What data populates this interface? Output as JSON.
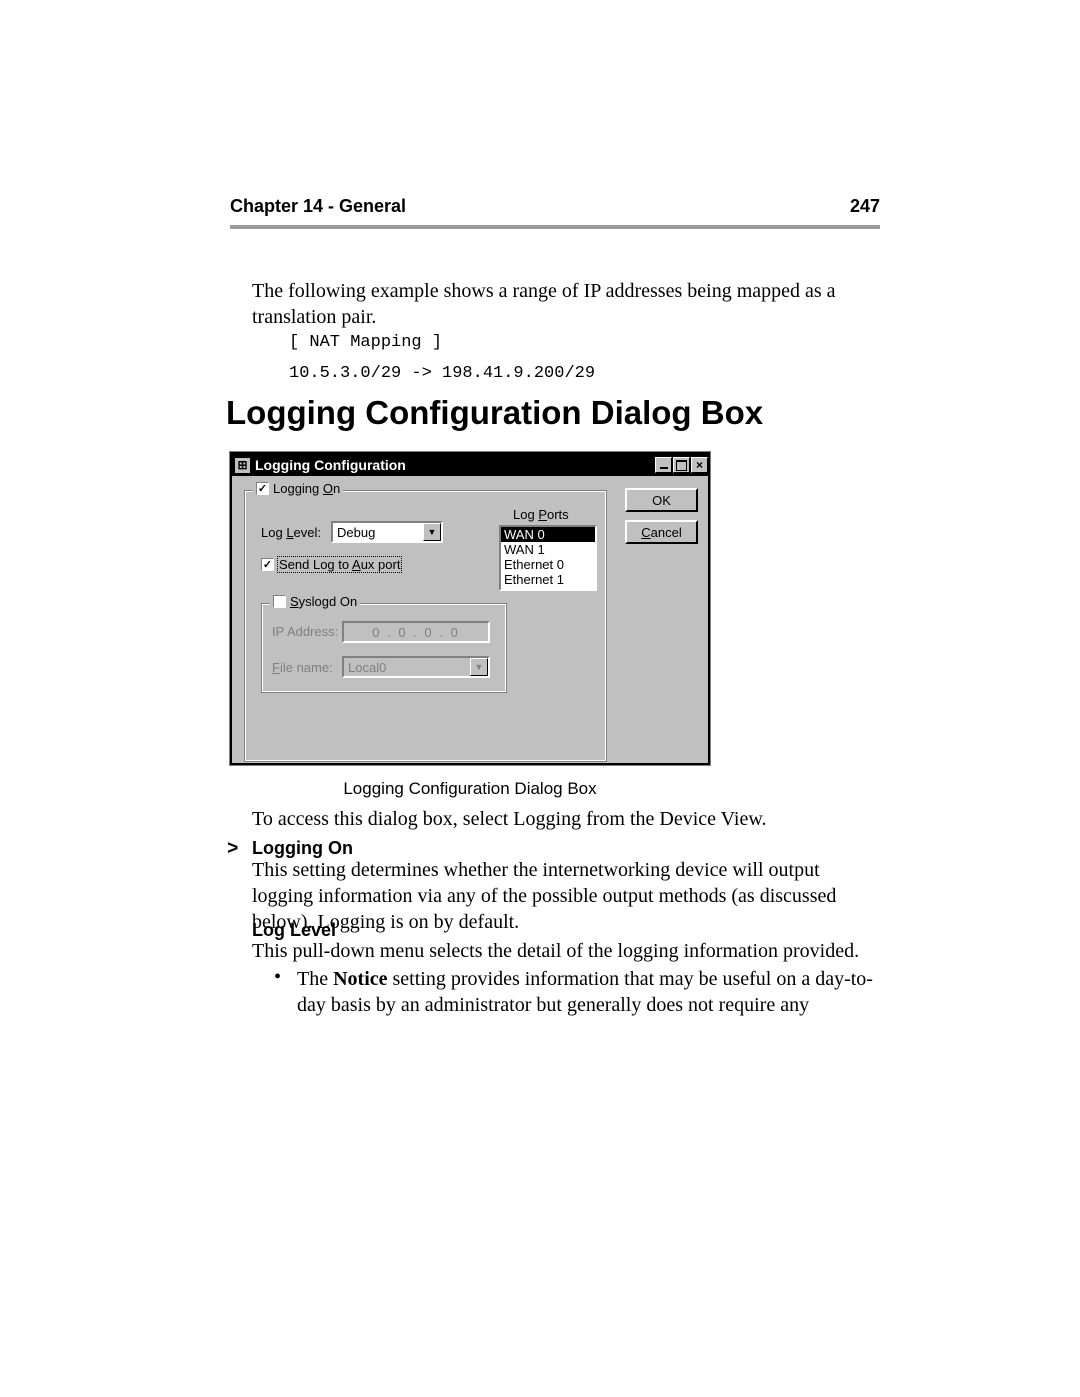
{
  "header": {
    "chapter": "Chapter 14 - General",
    "page": "247"
  },
  "intro": "The following example shows a range of IP addresses being mapped as a translation pair.",
  "code": "[ NAT Mapping ]\n10.5.3.0/29 -> 198.41.9.200/29",
  "section_heading": "Logging Configuration Dialog Box",
  "dialog": {
    "title": "Logging Configuration",
    "logging_on": {
      "label_pre": "Logging ",
      "label_u": "O",
      "label_post": "n",
      "checked": true
    },
    "log_level": {
      "label_pre": "Log ",
      "label_u": "L",
      "label_post": "evel:",
      "value": "Debug"
    },
    "aux": {
      "label_pre": "Send Log to ",
      "label_u": "A",
      "label_post": "ux port",
      "checked": true
    },
    "syslogd": {
      "label_u": "S",
      "label_post": "yslogd On",
      "checked": false
    },
    "ip_address_label": "IP Address:",
    "ip_address_value": "0  .  0  .  0  .  0",
    "file_name_label_u": "F",
    "file_name_label_post": "ile name:",
    "file_name_value": "Local0",
    "log_ports": {
      "label_pre": "Log ",
      "label_u": "P",
      "label_post": "orts",
      "items": [
        "WAN 0",
        "WAN 1",
        "Ethernet 0",
        "Ethernet 1"
      ],
      "selected_index": 0
    },
    "buttons": {
      "ok": "OK",
      "cancel_u": "C",
      "cancel_post": "ancel"
    }
  },
  "caption": "Logging Configuration Dialog Box",
  "access_para": "To access this dialog box, select Logging from the Device View.",
  "sub1": {
    "heading": "Logging On",
    "marker": ">",
    "text": "This setting determines whether the internetworking device will output logging information via any of the possible output methods (as discussed below). Logging is on by default."
  },
  "sub2": {
    "heading": "Log Level",
    "text": "This pull-down menu selects the detail of the logging information provided."
  },
  "bullet1": {
    "marker": "•",
    "pre": "The ",
    "bold": "Notice",
    "post": " setting provides information that may be useful on a day-to-day basis by an administrator but generally does not require any"
  }
}
